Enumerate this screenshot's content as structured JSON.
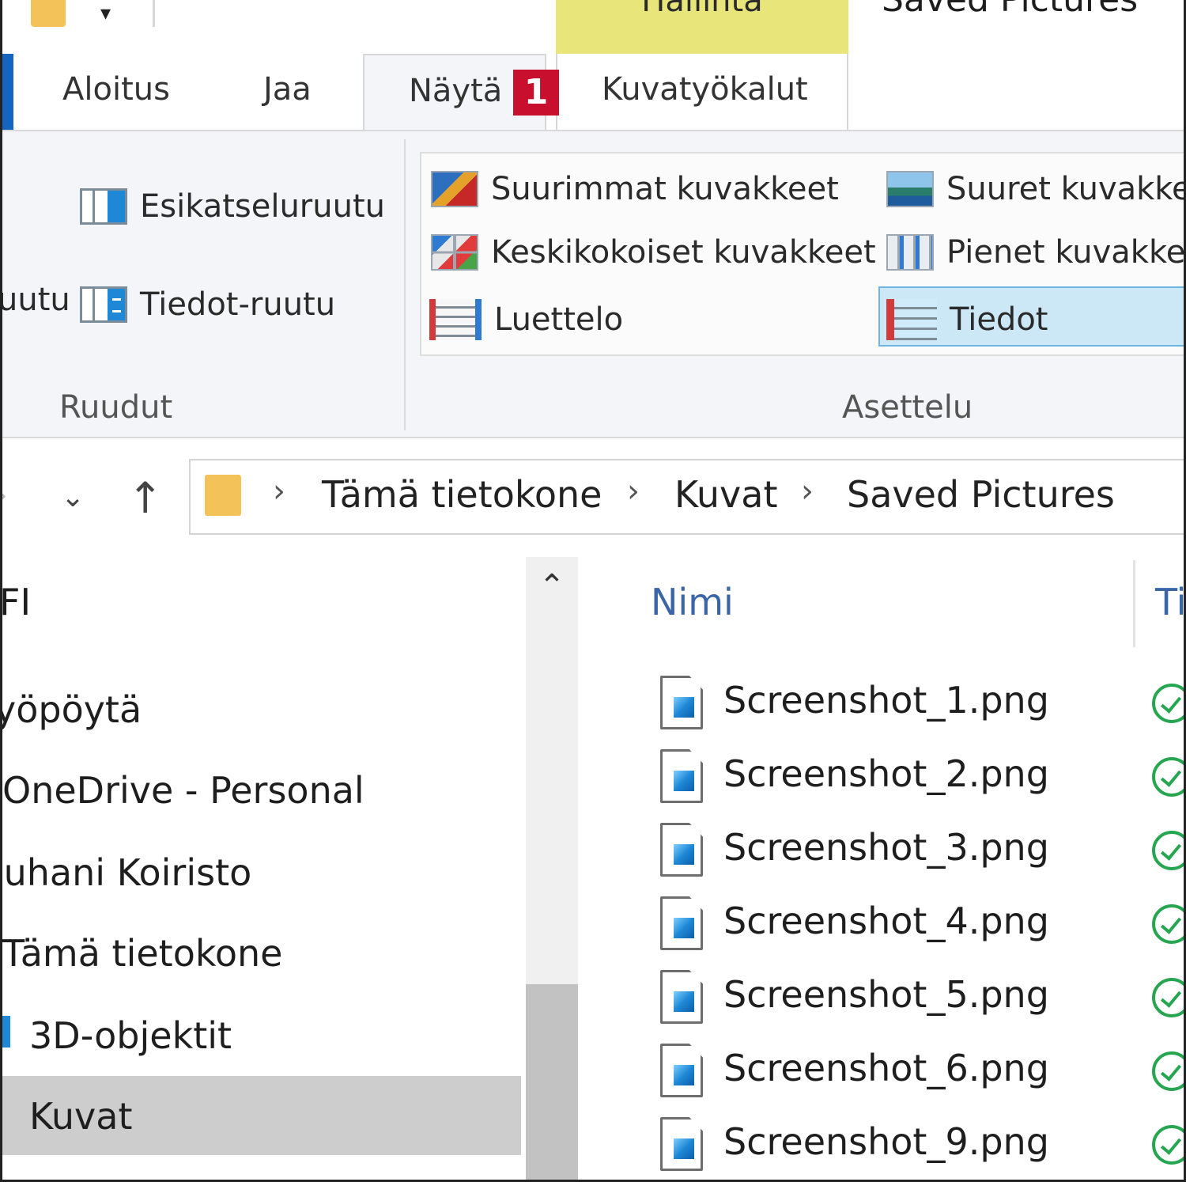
{
  "window": {
    "title": "Saved Pictures",
    "context_group": "Hallinta"
  },
  "tabs": [
    {
      "label": "Aloitus"
    },
    {
      "label": "Jaa"
    },
    {
      "label": "Näytä"
    },
    {
      "label": "Kuvatyökalut"
    }
  ],
  "badge": "1",
  "ribbon": {
    "panes": {
      "label_partial": "uutu",
      "preview": "Esikatseluruutu",
      "details": "Tiedot-ruutu",
      "group": "Ruudut"
    },
    "layout": {
      "items": [
        {
          "label": "Suurimmat kuvakkeet",
          "icon": "extra-large-icons-icon"
        },
        {
          "label": "Suuret kuvakke",
          "icon": "large-icons-icon"
        },
        {
          "label": "Keskikokoiset kuvakkeet",
          "icon": "medium-icons-icon"
        },
        {
          "label": "Pienet kuvakke",
          "icon": "small-icons-icon"
        },
        {
          "label": "Luettelo",
          "icon": "list-icon"
        },
        {
          "label": "Tiedot",
          "icon": "details-icon"
        }
      ],
      "selected": "Tiedot",
      "group": "Asettelu"
    }
  },
  "address": {
    "crumbs": [
      "Tämä tietokone",
      "Kuvat",
      "Saved Pictures"
    ]
  },
  "navpane": {
    "items": [
      {
        "label": "FI"
      },
      {
        "label": "yöpöytä"
      },
      {
        "label": "OneDrive - Personal"
      },
      {
        "label": "Juhani Koiristo"
      },
      {
        "label": "Tämä tietokone"
      },
      {
        "label": "3D-objektit"
      },
      {
        "label": "Kuvat"
      }
    ],
    "selected": "Kuvat"
  },
  "filelist": {
    "columns": [
      "Nimi",
      "Ti"
    ],
    "files": [
      {
        "name": "Screenshot_1.png",
        "status": "synced"
      },
      {
        "name": "Screenshot_2.png",
        "status": "synced"
      },
      {
        "name": "Screenshot_3.png",
        "status": "synced"
      },
      {
        "name": "Screenshot_4.png",
        "status": "synced"
      },
      {
        "name": "Screenshot_5.png",
        "status": "synced"
      },
      {
        "name": "Screenshot_6.png",
        "status": "synced"
      },
      {
        "name": "Screenshot_9.png",
        "status": "synced"
      }
    ]
  },
  "colors": {
    "accent": "#1e88d6",
    "badge": "#c8102e",
    "context_group": "#e8e67a",
    "selection": "#cce8f7",
    "sync_ok": "#26a650"
  }
}
